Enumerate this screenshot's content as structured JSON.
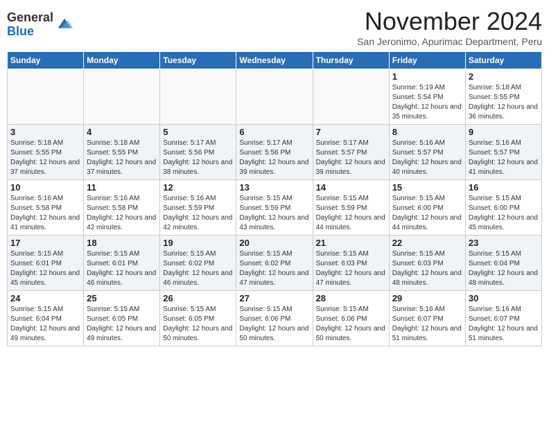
{
  "header": {
    "logo_line1": "General",
    "logo_line2": "Blue",
    "month": "November 2024",
    "location": "San Jeronimo, Apurimac Department, Peru"
  },
  "days_of_week": [
    "Sunday",
    "Monday",
    "Tuesday",
    "Wednesday",
    "Thursday",
    "Friday",
    "Saturday"
  ],
  "weeks": [
    {
      "days": [
        {
          "num": "",
          "info": ""
        },
        {
          "num": "",
          "info": ""
        },
        {
          "num": "",
          "info": ""
        },
        {
          "num": "",
          "info": ""
        },
        {
          "num": "",
          "info": ""
        },
        {
          "num": "1",
          "info": "Sunrise: 5:19 AM\nSunset: 5:54 PM\nDaylight: 12 hours and 35 minutes."
        },
        {
          "num": "2",
          "info": "Sunrise: 5:18 AM\nSunset: 5:55 PM\nDaylight: 12 hours and 36 minutes."
        }
      ]
    },
    {
      "days": [
        {
          "num": "3",
          "info": "Sunrise: 5:18 AM\nSunset: 5:55 PM\nDaylight: 12 hours and 37 minutes."
        },
        {
          "num": "4",
          "info": "Sunrise: 5:18 AM\nSunset: 5:55 PM\nDaylight: 12 hours and 37 minutes."
        },
        {
          "num": "5",
          "info": "Sunrise: 5:17 AM\nSunset: 5:56 PM\nDaylight: 12 hours and 38 minutes."
        },
        {
          "num": "6",
          "info": "Sunrise: 5:17 AM\nSunset: 5:56 PM\nDaylight: 12 hours and 39 minutes."
        },
        {
          "num": "7",
          "info": "Sunrise: 5:17 AM\nSunset: 5:57 PM\nDaylight: 12 hours and 39 minutes."
        },
        {
          "num": "8",
          "info": "Sunrise: 5:16 AM\nSunset: 5:57 PM\nDaylight: 12 hours and 40 minutes."
        },
        {
          "num": "9",
          "info": "Sunrise: 5:16 AM\nSunset: 5:57 PM\nDaylight: 12 hours and 41 minutes."
        }
      ]
    },
    {
      "days": [
        {
          "num": "10",
          "info": "Sunrise: 5:16 AM\nSunset: 5:58 PM\nDaylight: 12 hours and 41 minutes."
        },
        {
          "num": "11",
          "info": "Sunrise: 5:16 AM\nSunset: 5:58 PM\nDaylight: 12 hours and 42 minutes."
        },
        {
          "num": "12",
          "info": "Sunrise: 5:16 AM\nSunset: 5:59 PM\nDaylight: 12 hours and 42 minutes."
        },
        {
          "num": "13",
          "info": "Sunrise: 5:15 AM\nSunset: 5:59 PM\nDaylight: 12 hours and 43 minutes."
        },
        {
          "num": "14",
          "info": "Sunrise: 5:15 AM\nSunset: 5:59 PM\nDaylight: 12 hours and 44 minutes."
        },
        {
          "num": "15",
          "info": "Sunrise: 5:15 AM\nSunset: 6:00 PM\nDaylight: 12 hours and 44 minutes."
        },
        {
          "num": "16",
          "info": "Sunrise: 5:15 AM\nSunset: 6:00 PM\nDaylight: 12 hours and 45 minutes."
        }
      ]
    },
    {
      "days": [
        {
          "num": "17",
          "info": "Sunrise: 5:15 AM\nSunset: 6:01 PM\nDaylight: 12 hours and 45 minutes."
        },
        {
          "num": "18",
          "info": "Sunrise: 5:15 AM\nSunset: 6:01 PM\nDaylight: 12 hours and 46 minutes."
        },
        {
          "num": "19",
          "info": "Sunrise: 5:15 AM\nSunset: 6:02 PM\nDaylight: 12 hours and 46 minutes."
        },
        {
          "num": "20",
          "info": "Sunrise: 5:15 AM\nSunset: 6:02 PM\nDaylight: 12 hours and 47 minutes."
        },
        {
          "num": "21",
          "info": "Sunrise: 5:15 AM\nSunset: 6:03 PM\nDaylight: 12 hours and 47 minutes."
        },
        {
          "num": "22",
          "info": "Sunrise: 5:15 AM\nSunset: 6:03 PM\nDaylight: 12 hours and 48 minutes."
        },
        {
          "num": "23",
          "info": "Sunrise: 5:15 AM\nSunset: 6:04 PM\nDaylight: 12 hours and 48 minutes."
        }
      ]
    },
    {
      "days": [
        {
          "num": "24",
          "info": "Sunrise: 5:15 AM\nSunset: 6:04 PM\nDaylight: 12 hours and 49 minutes."
        },
        {
          "num": "25",
          "info": "Sunrise: 5:15 AM\nSunset: 6:05 PM\nDaylight: 12 hours and 49 minutes."
        },
        {
          "num": "26",
          "info": "Sunrise: 5:15 AM\nSunset: 6:05 PM\nDaylight: 12 hours and 50 minutes."
        },
        {
          "num": "27",
          "info": "Sunrise: 5:15 AM\nSunset: 6:06 PM\nDaylight: 12 hours and 50 minutes."
        },
        {
          "num": "28",
          "info": "Sunrise: 5:15 AM\nSunset: 6:06 PM\nDaylight: 12 hours and 50 minutes."
        },
        {
          "num": "29",
          "info": "Sunrise: 5:16 AM\nSunset: 6:07 PM\nDaylight: 12 hours and 51 minutes."
        },
        {
          "num": "30",
          "info": "Sunrise: 5:16 AM\nSunset: 6:07 PM\nDaylight: 12 hours and 51 minutes."
        }
      ]
    }
  ]
}
